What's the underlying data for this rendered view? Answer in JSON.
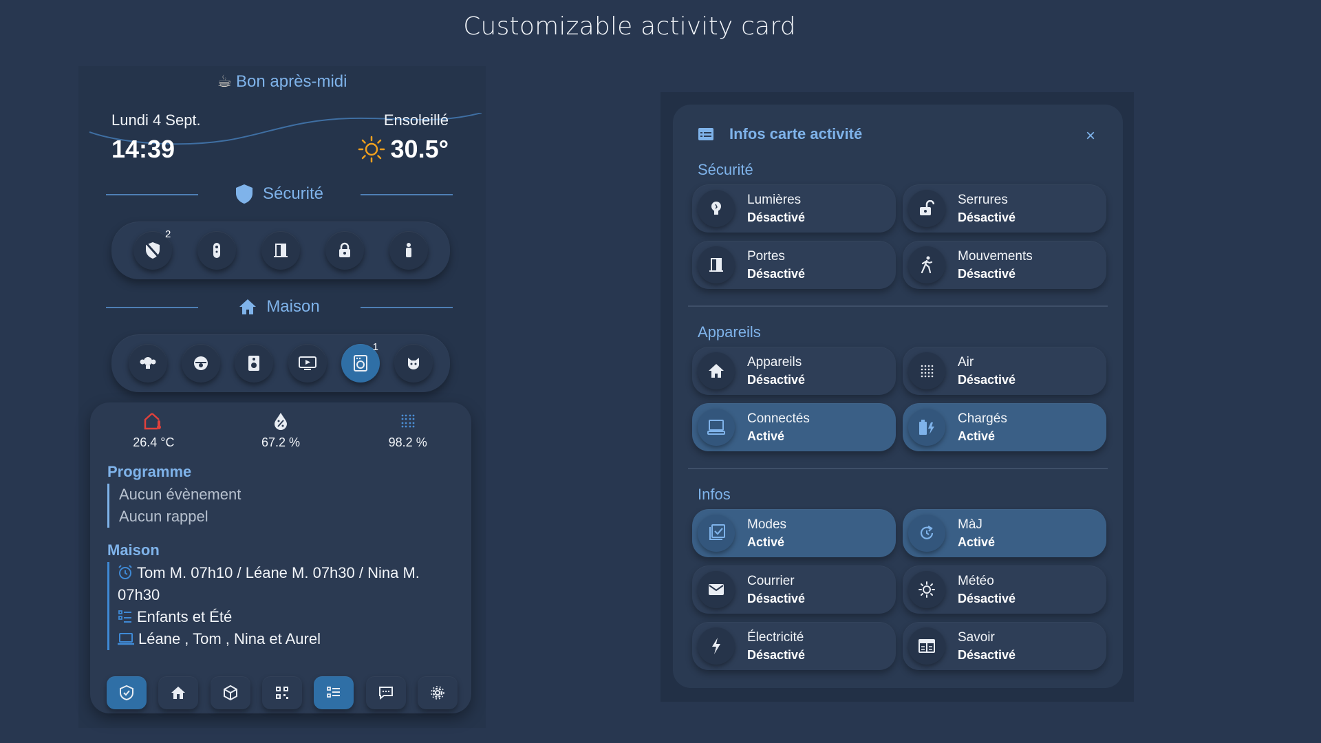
{
  "page": {
    "title": "Customizable activity card"
  },
  "left": {
    "greeting_icon": "coffee-cup-icon",
    "greeting": "Bon après-midi",
    "date": "Lundi 4 Sept.",
    "time": "14:39",
    "weather": {
      "condition": "Ensoleillé",
      "temperature": "30.5°",
      "icon": "sun-icon"
    },
    "security": {
      "label": "Sécurité",
      "icon": "shield-icon",
      "buttons": [
        {
          "icon": "shield-off-icon",
          "badge": "2"
        },
        {
          "icon": "remote-icon",
          "badge": ""
        },
        {
          "icon": "door-icon",
          "badge": ""
        },
        {
          "icon": "lock-icon",
          "badge": ""
        },
        {
          "icon": "person-icon",
          "badge": ""
        }
      ]
    },
    "home": {
      "label": "Maison",
      "icon": "house-icon",
      "buttons": [
        {
          "icon": "lightbulb-group-icon",
          "badge": "",
          "active": false
        },
        {
          "icon": "robot-vacuum-icon",
          "badge": "",
          "active": false
        },
        {
          "icon": "speaker-icon",
          "badge": "",
          "active": false
        },
        {
          "icon": "tv-play-icon",
          "badge": "",
          "active": false
        },
        {
          "icon": "washing-machine-icon",
          "badge": "1",
          "active": true
        },
        {
          "icon": "cat-icon",
          "badge": "",
          "active": false
        }
      ]
    },
    "sensors": [
      {
        "icon": "home-thermometer-icon",
        "value": "26.4 °C",
        "color": "#e0413c"
      },
      {
        "icon": "water-percent-icon",
        "value": "67.2 %",
        "color": "#e9edf3"
      },
      {
        "icon": "air-dots-icon",
        "value": "98.2 %",
        "color": "#4c8fd6"
      }
    ],
    "programme": {
      "title": "Programme",
      "items": [
        "Aucun évènement",
        "Aucun rappel"
      ]
    },
    "maison": {
      "title": "Maison",
      "items": [
        {
          "icon": "alarm-clock-icon",
          "text": "Tom M. 07h10 / Léane M. 07h30 / Nina M. 07h30"
        },
        {
          "icon": "list-icon",
          "text": "Enfants et Été"
        },
        {
          "icon": "laptop-icon",
          "text": "Léane , Tom , Nina et Aurel"
        }
      ]
    },
    "nav": [
      {
        "icon": "shield-check-icon",
        "active": true
      },
      {
        "icon": "home-group-icon",
        "active": false
      },
      {
        "icon": "cube-icon",
        "active": false
      },
      {
        "icon": "qr-code-icon",
        "active": false
      },
      {
        "icon": "list-icon",
        "active": true
      },
      {
        "icon": "chat-icon",
        "active": false
      },
      {
        "icon": "gear-icon",
        "active": false
      }
    ]
  },
  "right": {
    "title": "Infos carte activité",
    "title_icon": "card-text-icon",
    "close_icon": "close-icon",
    "close_label": "×",
    "sections": [
      {
        "title": "Sécurité",
        "tiles": [
          {
            "name": "Lumières",
            "status": "Désactivé",
            "on": false,
            "icon": "lightbulb-icon"
          },
          {
            "name": "Serrures",
            "status": "Désactivé",
            "on": false,
            "icon": "lock-open-icon"
          },
          {
            "name": "Portes",
            "status": "Désactivé",
            "on": false,
            "icon": "door-icon"
          },
          {
            "name": "Mouvements",
            "status": "Désactivé",
            "on": false,
            "icon": "walking-icon"
          }
        ]
      },
      {
        "title": "Appareils",
        "tiles": [
          {
            "name": "Appareils",
            "status": "Désactivé",
            "on": false,
            "icon": "house-icon"
          },
          {
            "name": "Air",
            "status": "Désactivé",
            "on": false,
            "icon": "air-dots-icon"
          },
          {
            "name": "Connectés",
            "status": "Activé",
            "on": true,
            "icon": "laptop-icon"
          },
          {
            "name": "Chargés",
            "status": "Activé",
            "on": true,
            "icon": "battery-charging-icon"
          }
        ]
      },
      {
        "title": "Infos",
        "tiles": [
          {
            "name": "Modes",
            "status": "Activé",
            "on": true,
            "icon": "checkbox-icon"
          },
          {
            "name": "MàJ",
            "status": "Activé",
            "on": true,
            "icon": "update-icon"
          },
          {
            "name": "Courrier",
            "status": "Désactivé",
            "on": false,
            "icon": "mail-icon"
          },
          {
            "name": "Météo",
            "status": "Désactivé",
            "on": false,
            "icon": "weather-sun-icon"
          },
          {
            "name": "Électricité",
            "status": "Désactivé",
            "on": false,
            "icon": "flash-icon"
          },
          {
            "name": "Savoir",
            "status": "Désactivé",
            "on": false,
            "icon": "book-icon"
          }
        ]
      }
    ]
  }
}
